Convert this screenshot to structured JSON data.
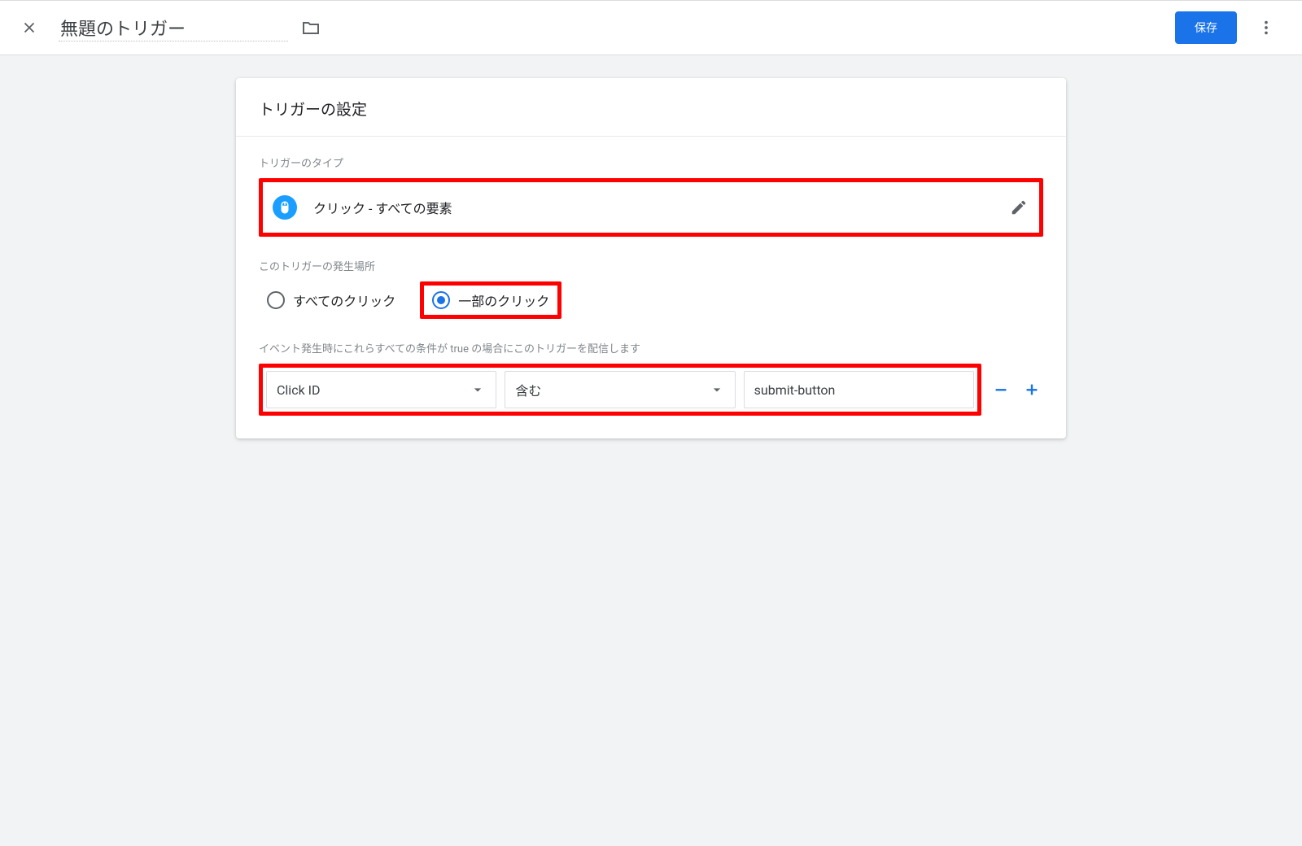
{
  "header": {
    "title_value": "無題のトリガー",
    "save_label": "保存"
  },
  "card": {
    "title": "トリガーの設定",
    "type_section_label": "トリガーのタイプ",
    "type_value": "クリック - すべての要素",
    "fire_section_label": "このトリガーの発生場所",
    "radio_all_label": "すべてのクリック",
    "radio_some_label": "一部のクリック",
    "conditions_label": "イベント発生時にこれらすべての条件が true の場合にこのトリガーを配信します",
    "condition": {
      "variable": "Click ID",
      "operator": "含む",
      "value": "submit-button"
    }
  }
}
